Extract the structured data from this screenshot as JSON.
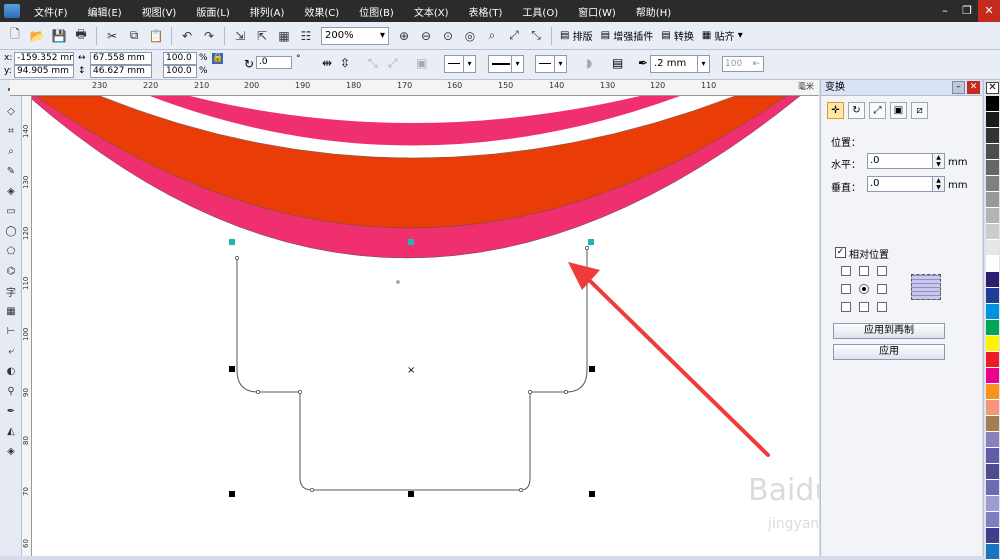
{
  "menu": [
    "文件(F)",
    "编辑(E)",
    "视图(V)",
    "版面(L)",
    "排列(A)",
    "效果(C)",
    "位图(B)",
    "文本(X)",
    "表格(T)",
    "工具(O)",
    "窗口(W)",
    "帮助(H)"
  ],
  "toolbar": {
    "zoom": "200%",
    "arrange_label": "排版",
    "plugin_label": "增强插件",
    "convert_label": "转换",
    "snap_label": "贴齐"
  },
  "props": {
    "x_label": "x:",
    "x_value": "-159.352 mm",
    "y_label": "y:",
    "y_value": "94.905 mm",
    "w_value": "67.558 mm",
    "h_value": "46.627 mm",
    "sx_value": "100.0",
    "sy_value": "100.0",
    "pct": "%",
    "rot_value": ".0",
    "deg": "°",
    "outline_width": ".2 mm",
    "count_value": "100"
  },
  "ruler": {
    "h_ticks": [
      "230",
      "220",
      "210",
      "200",
      "190",
      "180",
      "170",
      "160",
      "150",
      "140",
      "130",
      "120",
      "110"
    ],
    "h_unit": "毫米",
    "v_ticks": [
      "140",
      "130",
      "120",
      "110",
      "100",
      "90",
      "80",
      "70",
      "60"
    ]
  },
  "docker": {
    "title": "变换",
    "position_label": "位置：",
    "h_label": "水平：",
    "h_value": ".0",
    "h_unit": "mm",
    "v_label": "垂直：",
    "v_value": ".0",
    "v_unit": "mm",
    "relative_label": "相对位置",
    "apply_copy_label": "应用到再制",
    "apply_label": "应用"
  },
  "watermark": {
    "brand": "Baidu 经验",
    "url": "jingyan.baidu.com"
  },
  "colors": {
    "ring_outer": "#f0306e",
    "ring_inner": "#ea3c06",
    "arrow": "#ee3b3b",
    "palette": [
      "#000000",
      "#1a1a1a",
      "#333333",
      "#4d4d4d",
      "#666666",
      "#808080",
      "#999999",
      "#b3b3b3",
      "#cccccc",
      "#e6e6e6",
      "#ffffff",
      "#2c1d6e",
      "#1c3f94",
      "#0093dd",
      "#00a651",
      "#fff200",
      "#ed1c24",
      "#ec008c",
      "#f7941d",
      "#f69679",
      "#a67c52",
      "#8781bd",
      "#605ca8",
      "#4f4c8d",
      "#6d6bb1",
      "#9e9bd1",
      "#7f7fbf",
      "#3e3e8c",
      "#1a75bc"
    ]
  }
}
